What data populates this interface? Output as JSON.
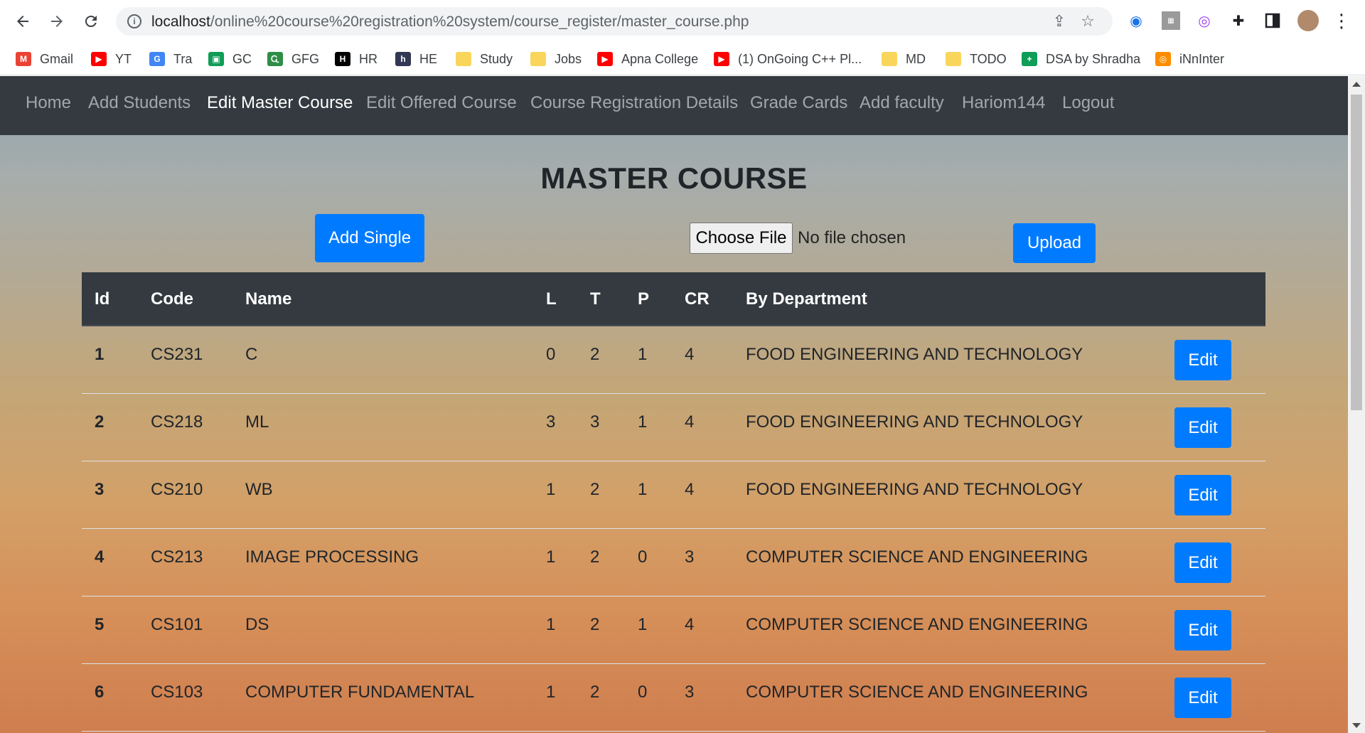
{
  "browser": {
    "url_host": "localhost",
    "url_path": "/online%20course%20registration%20system/course_register/master_course.php",
    "bookmarks": [
      {
        "label": "Gmail",
        "icon": "gmail-icon",
        "color": "#ea4335",
        "glyph": "M"
      },
      {
        "label": "YT",
        "icon": "youtube-icon",
        "color": "#ff0000",
        "glyph": "▶"
      },
      {
        "label": "Tra",
        "icon": "translate-icon",
        "color": "#4285f4",
        "glyph": "G"
      },
      {
        "label": "GC",
        "icon": "classroom-icon",
        "color": "#0f9d58",
        "glyph": "▣"
      },
      {
        "label": "GFG",
        "icon": "gfg-icon",
        "color": "#2f8d46",
        "glyph": "Ꮹ"
      },
      {
        "label": "HR",
        "icon": "hackerrank-icon",
        "color": "#000000",
        "glyph": "H"
      },
      {
        "label": "HE",
        "icon": "hackerearth-icon",
        "color": "#323754",
        "glyph": "h"
      },
      {
        "label": "Study",
        "icon": "folder-icon",
        "color": "#f9d65b",
        "glyph": ""
      },
      {
        "label": "Jobs",
        "icon": "folder-icon",
        "color": "#f9d65b",
        "glyph": ""
      },
      {
        "label": "Apna College",
        "icon": "youtube-icon",
        "color": "#ff0000",
        "glyph": "▶"
      },
      {
        "label": "(1) OnGoing C++ Pl...",
        "icon": "youtube-icon",
        "color": "#ff0000",
        "glyph": "▶"
      },
      {
        "label": "MD",
        "icon": "folder-icon",
        "color": "#f9d65b",
        "glyph": ""
      },
      {
        "label": "TODO",
        "icon": "folder-icon",
        "color": "#f9d65b",
        "glyph": ""
      },
      {
        "label": "DSA by Shradha",
        "icon": "sheets-icon",
        "color": "#0f9d58",
        "glyph": "+"
      },
      {
        "label": "iNnInter",
        "icon": "site-icon",
        "color": "#ff8c00",
        "glyph": "◎"
      }
    ]
  },
  "navbar": {
    "items": [
      {
        "label": "Home",
        "active": false
      },
      {
        "label": "Add Students",
        "active": false
      },
      {
        "label": "Edit Master Course",
        "active": true
      },
      {
        "label": "Edit Offered Course",
        "active": false
      },
      {
        "label": "Course Registration Details",
        "active": false
      },
      {
        "label": "Grade Cards",
        "active": false
      },
      {
        "label": "Add faculty",
        "active": false
      },
      {
        "label": "Hariom144",
        "active": false
      },
      {
        "label": "Logout",
        "active": false
      }
    ]
  },
  "main": {
    "title": "MASTER COURSE",
    "add_single_label": "Add Single",
    "choose_file_label": "Choose File",
    "file_status": "No file chosen",
    "upload_label": "Upload"
  },
  "table": {
    "headers": [
      "Id",
      "Code",
      "Name",
      "L",
      "T",
      "P",
      "CR",
      "By Department"
    ],
    "edit_label": "Edit",
    "rows": [
      {
        "id": "1",
        "code": "CS231",
        "name": "C",
        "l": "0",
        "t": "2",
        "p": "1",
        "cr": "4",
        "dept": "FOOD ENGINEERING AND TECHNOLOGY"
      },
      {
        "id": "2",
        "code": "CS218",
        "name": "ML",
        "l": "3",
        "t": "3",
        "p": "1",
        "cr": "4",
        "dept": "FOOD ENGINEERING AND TECHNOLOGY"
      },
      {
        "id": "3",
        "code": "CS210",
        "name": "WB",
        "l": "1",
        "t": "2",
        "p": "1",
        "cr": "4",
        "dept": "FOOD ENGINEERING AND TECHNOLOGY"
      },
      {
        "id": "4",
        "code": "CS213",
        "name": "IMAGE PROCESSING",
        "l": "1",
        "t": "2",
        "p": "0",
        "cr": "3",
        "dept": "COMPUTER SCIENCE AND ENGINEERING"
      },
      {
        "id": "5",
        "code": "CS101",
        "name": "DS",
        "l": "1",
        "t": "2",
        "p": "1",
        "cr": "4",
        "dept": "COMPUTER SCIENCE AND ENGINEERING"
      },
      {
        "id": "6",
        "code": "CS103",
        "name": "COMPUTER FUNDAMENTAL",
        "l": "1",
        "t": "2",
        "p": "0",
        "cr": "3",
        "dept": "COMPUTER SCIENCE AND ENGINEERING"
      }
    ]
  }
}
